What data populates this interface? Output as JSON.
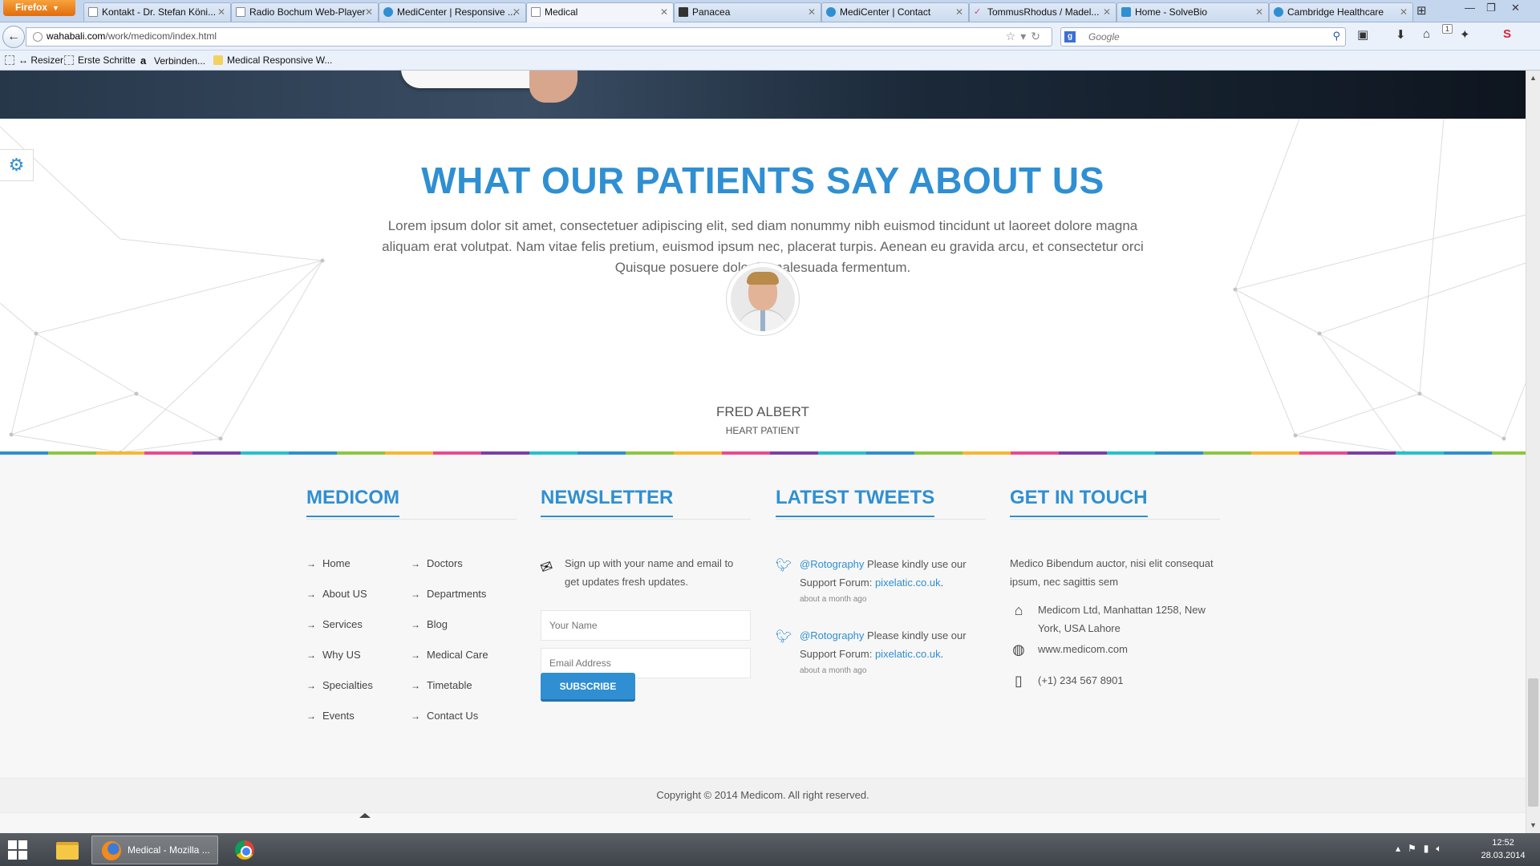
{
  "browser": {
    "menu_button": "Firefox",
    "tabs": [
      {
        "label": "Kontakt - Dr. Stefan Köni...",
        "icon": "blank-page-icon",
        "active": false
      },
      {
        "label": "Radio Bochum Web-Player",
        "icon": "blank-page-icon",
        "active": false
      },
      {
        "label": "MediCenter | Responsive ...",
        "icon": "medicenter-icon",
        "active": false
      },
      {
        "label": "Medical",
        "icon": "blank-page-icon",
        "active": true
      },
      {
        "label": "Panacea",
        "icon": "panacea-icon",
        "active": false
      },
      {
        "label": "MediCenter | Contact",
        "icon": "medicenter-icon",
        "active": false
      },
      {
        "label": "TommusRhodus / Madel...",
        "icon": "tommus-icon",
        "active": false
      },
      {
        "label": "Home - SolveBio",
        "icon": "solvebio-icon",
        "active": false
      },
      {
        "label": "Cambridge Healthcare",
        "icon": "cambridge-icon",
        "active": false
      }
    ],
    "url_domain": "wahabali.com",
    "url_path": "/work/medicom/index.html",
    "search_placeholder": "Google",
    "notification_count": "1",
    "bookmarks": [
      "Resizer",
      "Erste Schritte",
      "Verbinden...",
      "Medical Responsive W..."
    ]
  },
  "testimonials": {
    "title": "WHAT OUR PATIENTS SAY ABOUT US",
    "text": "Lorem ipsum dolor sit amet, consectetuer adipiscing elit, sed diam nonummy nibh euismod tincidunt ut laoreet dolore magna aliquam erat volutpat. Nam vitae felis pretium, euismod ipsum nec, placerat turpis. Aenean eu gravida arcu, et consectetur orci Quisque posuere dolor in malesuada fermentum.",
    "name": "FRED ALBERT",
    "role": "HEART PATIENT",
    "slides": 3,
    "active_slide": 1
  },
  "footer": {
    "medicom": {
      "heading": "MEDICOM",
      "links_col1": [
        "Home",
        "About US",
        "Services",
        "Why US",
        "Specialties",
        "Events"
      ],
      "links_col2": [
        "Doctors",
        "Departments",
        "Blog",
        "Medical Care",
        "Timetable",
        "Contact Us"
      ]
    },
    "newsletter": {
      "heading": "NEWSLETTER",
      "text": "Sign up with your name and email to get updates fresh updates.",
      "name_placeholder": "Your Name",
      "email_placeholder": "Email Address",
      "button": "SUBSCRIBE"
    },
    "tweets": {
      "heading": "LATEST TWEETS",
      "items": [
        {
          "handle": "@Rotography",
          "text": "Please kindly use our Support Forum:",
          "link": "pixelatic.co.uk",
          "after": ".",
          "ago": "about a month ago"
        },
        {
          "handle": "@Rotography",
          "text": "Please kindly use our Support Forum:",
          "link": "pixelatic.co.uk",
          "after": ".",
          "ago": "about a month ago"
        }
      ]
    },
    "contact": {
      "heading": "GET IN TOUCH",
      "intro": "Medico Bibendum auctor, nisi elit consequat ipsum, nec sagittis sem",
      "address": "Medicom Ltd, Manhattan 1258, New York, USA Lahore",
      "website": "www.medicom.com",
      "phone": "(+1) 234 567 8901"
    },
    "copyright": "Copyright © 2014 Medicom. All right reserved."
  },
  "taskbar": {
    "firefox_label": "Medical - Mozilla ...",
    "time": "12:52",
    "date": "28.03.2014"
  },
  "colors": {
    "accent": "#2f8fd2",
    "footer_bg": "#f7f7f7",
    "text": "#666666"
  }
}
